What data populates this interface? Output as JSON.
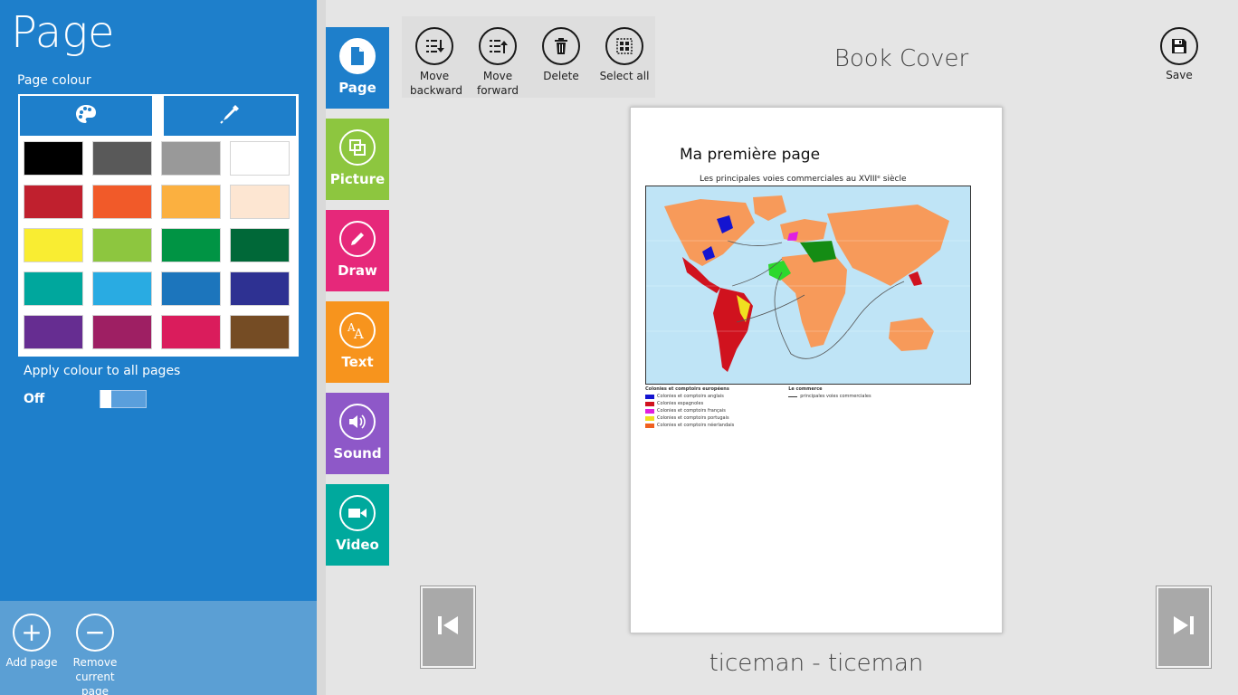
{
  "panel": {
    "title": "Page",
    "page_colour_label": "Page colour",
    "apply_label": "Apply colour to all pages",
    "toggle_state": "Off",
    "swatches": [
      "#000000",
      "#595959",
      "#999999",
      "#ffffff",
      "#c0202e",
      "#f15a29",
      "#fbb040",
      "#fde6d2",
      "#f9ed32",
      "#8dc63f",
      "#009444",
      "#006838",
      "#00a79d",
      "#29abe2",
      "#1c75bc",
      "#2e3192",
      "#662d91",
      "#9e1f63",
      "#da1c5c",
      "#754c24"
    ],
    "add_page_label": "Add page",
    "remove_page_label": "Remove current page"
  },
  "categories": [
    {
      "label": "Page",
      "color": "#1e7fcb",
      "icon": "page-icon",
      "active": true
    },
    {
      "label": "Picture",
      "color": "#8dc63f",
      "icon": "picture-icon",
      "active": false
    },
    {
      "label": "Draw",
      "color": "#e6287a",
      "icon": "pencil-icon",
      "active": false
    },
    {
      "label": "Text",
      "color": "#f7941d",
      "icon": "text-icon",
      "active": false
    },
    {
      "label": "Sound",
      "color": "#8e58c8",
      "icon": "speaker-icon",
      "active": false
    },
    {
      "label": "Video",
      "color": "#00a99d",
      "icon": "video-camera-icon",
      "active": false
    }
  ],
  "toolbar": {
    "move_backward": "Move backward",
    "move_forward": "Move forward",
    "delete": "Delete",
    "select_all": "Select all",
    "save": "Save"
  },
  "book_title": "Book Cover",
  "page": {
    "heading": "Ma première page",
    "map_caption": "Les principales voies commerciales au XVIIIᵉ siècle",
    "legend_title": "Colonies et comptoirs européens",
    "legend_trade_title": "Le commerce",
    "legend_trade_item": "principales voies commerciales",
    "legend": [
      {
        "label": "Colonies et comptoirs anglais",
        "color": "#1414d0"
      },
      {
        "label": "Colonies espagnoles",
        "color": "#d0121e"
      },
      {
        "label": "Colonies et comptoirs français",
        "color": "#e020e0"
      },
      {
        "label": "Colonies et comptoirs portugais",
        "color": "#f0e020"
      },
      {
        "label": "Colonies et comptoirs néerlandais",
        "color": "#f06020"
      }
    ]
  },
  "author": "ticeman - ticeman"
}
